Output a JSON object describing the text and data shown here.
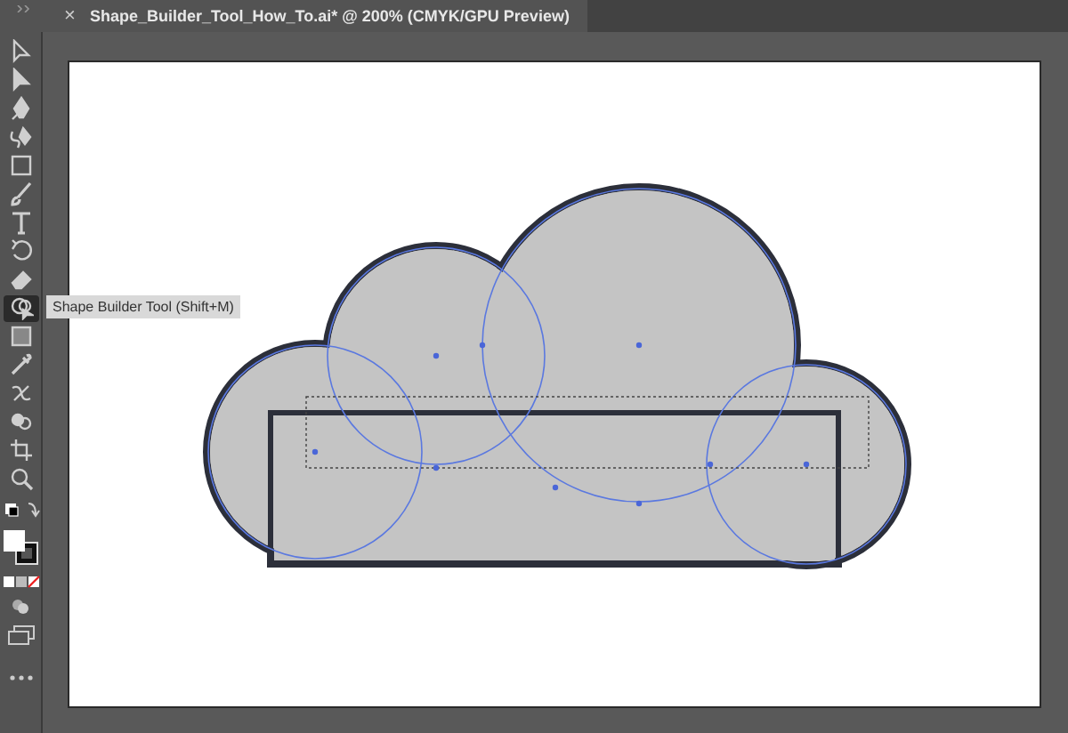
{
  "document_tab": {
    "close": "×",
    "title": "Shape_Builder_Tool_How_To.ai* @ 200% (CMYK/GPU Preview)"
  },
  "toolbar": {
    "tools": [
      {
        "kind": "direct-select",
        "selected": false
      },
      {
        "kind": "select",
        "selected": false
      },
      {
        "kind": "pen",
        "selected": false
      },
      {
        "kind": "curvature",
        "selected": false
      },
      {
        "kind": "rectangle",
        "selected": false
      },
      {
        "kind": "brush",
        "selected": false
      },
      {
        "kind": "type",
        "selected": false
      },
      {
        "kind": "rotate",
        "selected": false
      },
      {
        "kind": "eraser",
        "selected": false
      },
      {
        "kind": "shape-builder",
        "selected": true,
        "tooltip": "Shape Builder Tool (Shift+M)"
      },
      {
        "kind": "gradient",
        "selected": false
      },
      {
        "kind": "eyedropper",
        "selected": false
      },
      {
        "kind": "blend",
        "selected": false
      },
      {
        "kind": "symbol",
        "selected": false
      },
      {
        "kind": "artboard",
        "selected": false
      },
      {
        "kind": "zoom",
        "selected": false
      }
    ]
  }
}
